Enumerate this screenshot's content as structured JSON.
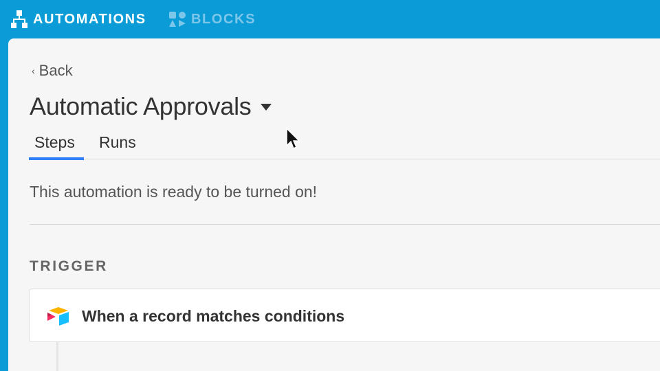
{
  "topnav": {
    "automations_label": "AUTOMATIONS",
    "blocks_label": "BLOCKS",
    "automations_icon": "automations-icon",
    "blocks_icon": "blocks-icon"
  },
  "main": {
    "back_label": "Back",
    "title": "Automatic Approvals",
    "tabs": [
      {
        "label": "Steps",
        "active": true
      },
      {
        "label": "Runs",
        "active": false
      }
    ],
    "status_message": "This automation is ready to be turned on!",
    "trigger_section_label": "TRIGGER",
    "trigger": {
      "label": "When a record matches conditions",
      "icon": "airtable-logo-icon"
    }
  },
  "colors": {
    "brand_blue": "#0b9cd7",
    "tab_accent": "#2d7ff9"
  }
}
